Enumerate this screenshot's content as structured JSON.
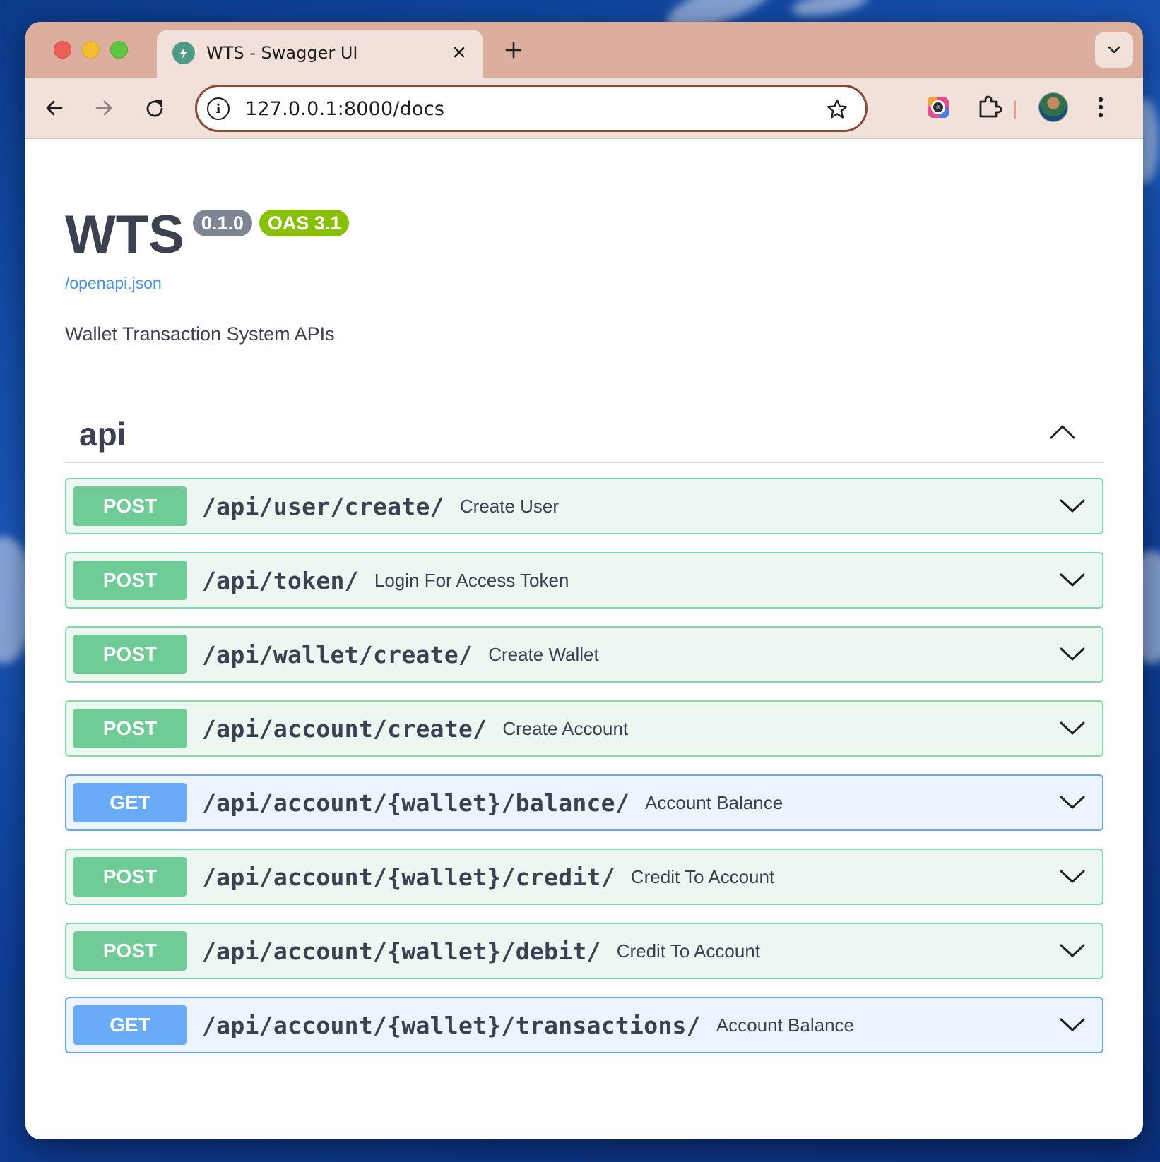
{
  "browser": {
    "tab_title": "WTS - Swagger UI",
    "url": "127.0.0.1:8000/docs"
  },
  "info": {
    "title": "WTS",
    "version": "0.1.0",
    "oas": "OAS 3.1",
    "spec_link": "/openapi.json",
    "description": "Wallet Transaction System APIs"
  },
  "tag": {
    "name": "api",
    "expanded": true
  },
  "colors": {
    "post": "#49cc90",
    "get": "#61affe",
    "title": "#3b4151",
    "link": "#4990e2"
  },
  "operations": [
    {
      "method": "POST",
      "path": "/api/user/create/",
      "summary": "Create User"
    },
    {
      "method": "POST",
      "path": "/api/token/",
      "summary": "Login For Access Token"
    },
    {
      "method": "POST",
      "path": "/api/wallet/create/",
      "summary": "Create Wallet"
    },
    {
      "method": "POST",
      "path": "/api/account/create/",
      "summary": "Create Account"
    },
    {
      "method": "GET",
      "path": "/api/account/{wallet}/balance/",
      "summary": "Account Balance"
    },
    {
      "method": "POST",
      "path": "/api/account/{wallet}/credit/",
      "summary": "Credit To Account"
    },
    {
      "method": "POST",
      "path": "/api/account/{wallet}/debit/",
      "summary": "Credit To Account"
    },
    {
      "method": "GET",
      "path": "/api/account/{wallet}/transactions/",
      "summary": "Account Balance"
    }
  ]
}
